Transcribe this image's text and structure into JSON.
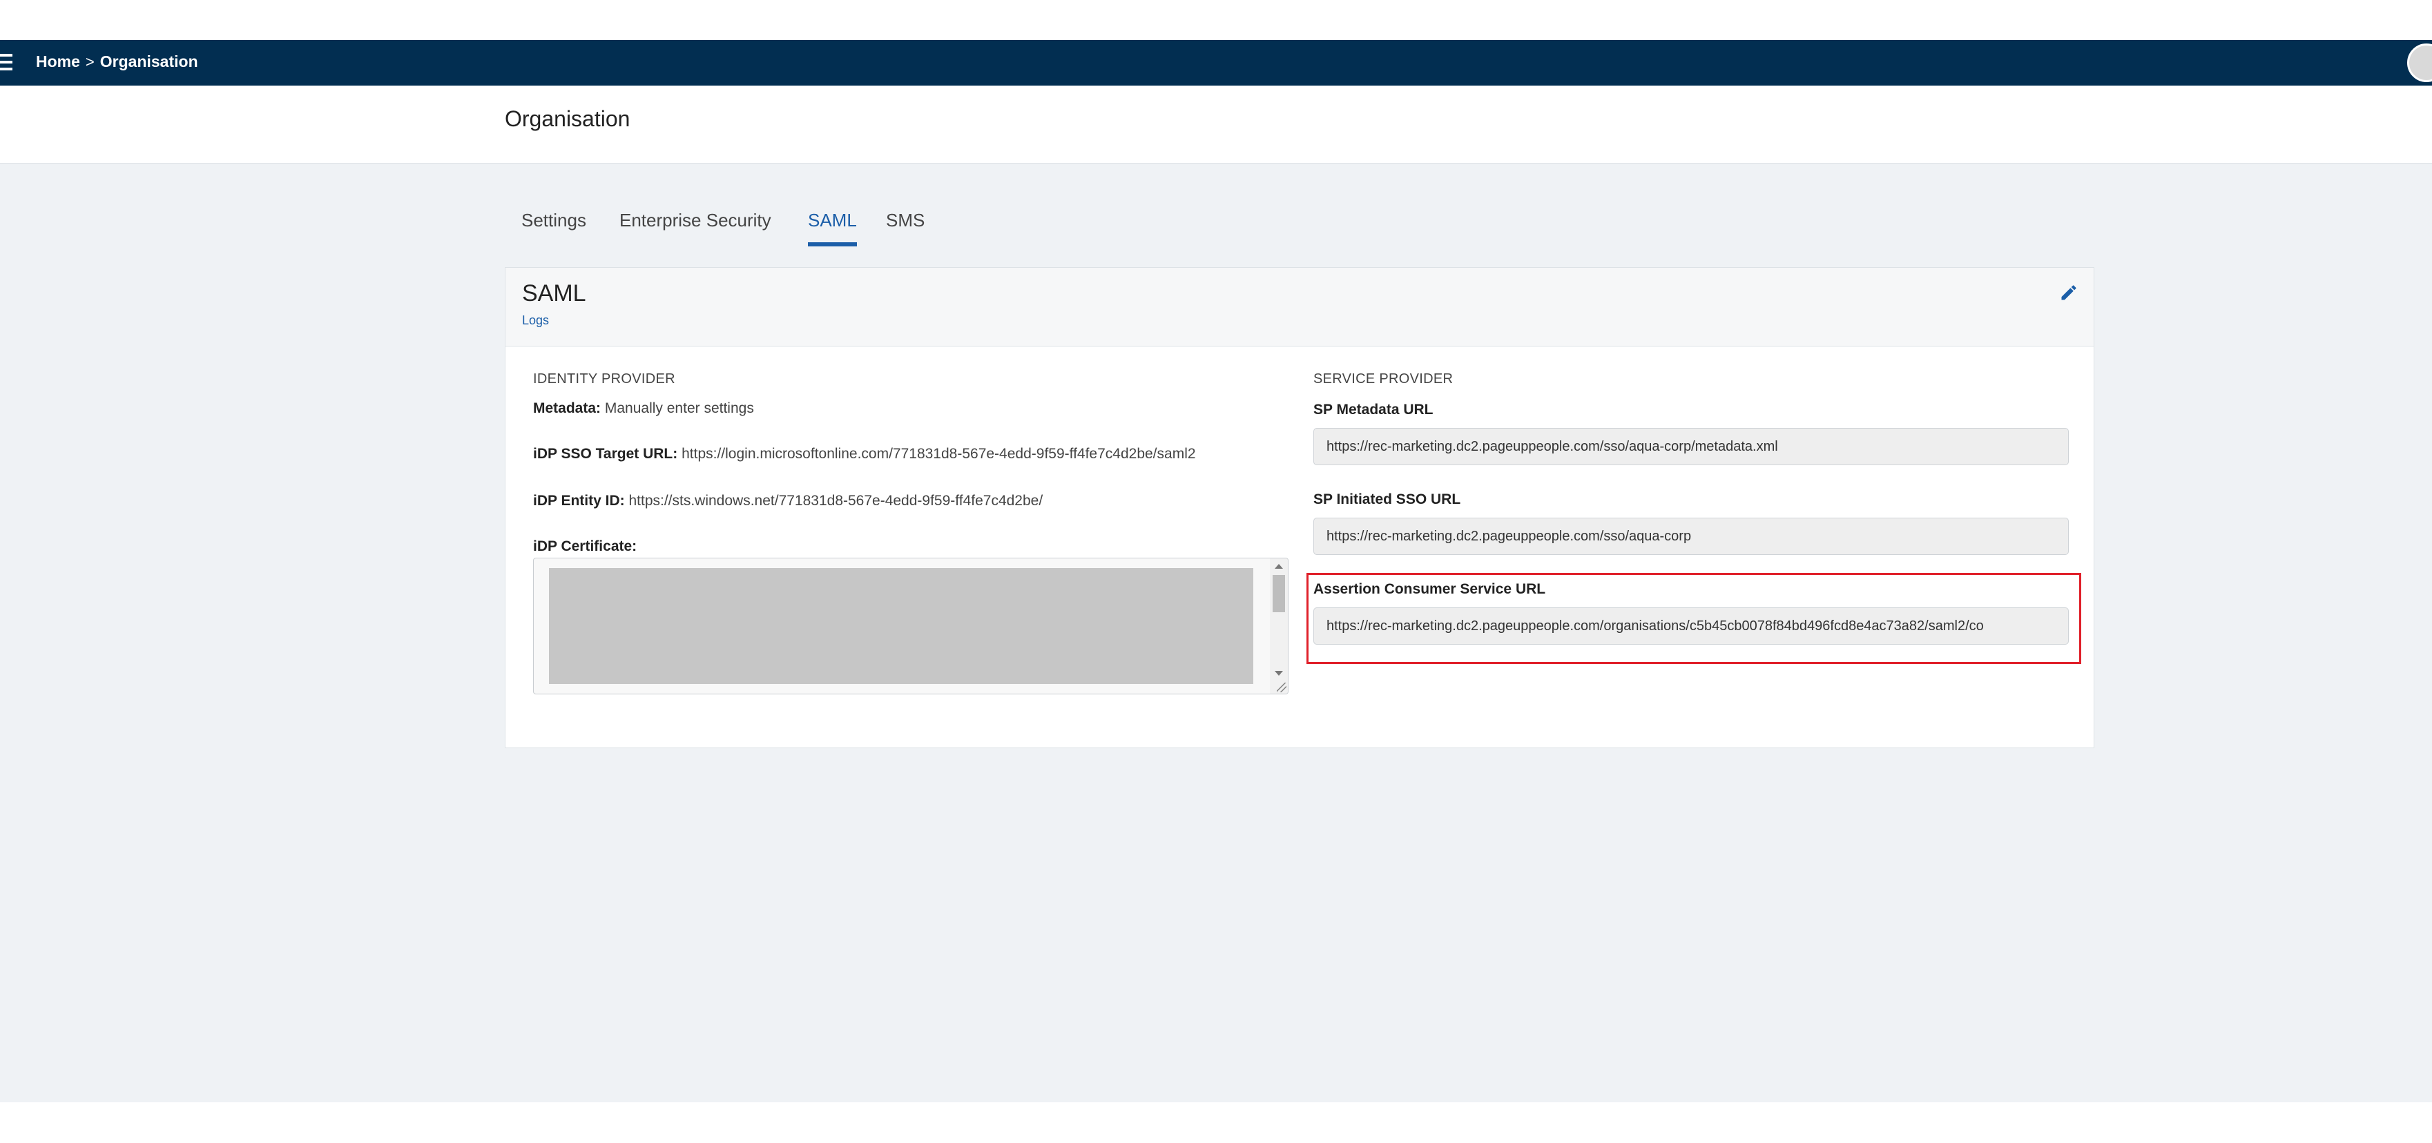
{
  "topbar": {
    "breadcrumb": {
      "home": "Home",
      "separator": ">",
      "current": "Organisation"
    }
  },
  "page": {
    "title": "Organisation"
  },
  "tabs": [
    {
      "label": "Settings",
      "active": false
    },
    {
      "label": "Enterprise Security",
      "active": false
    },
    {
      "label": "SAML",
      "active": true
    },
    {
      "label": "SMS",
      "active": false
    }
  ],
  "card": {
    "title": "SAML",
    "logs_link": "Logs"
  },
  "identity_provider": {
    "heading": "IDENTITY PROVIDER",
    "metadata_key": "Metadata:",
    "metadata_value": "Manually enter settings",
    "sso_url_key": "iDP SSO Target URL:",
    "sso_url_value": "https://login.microsoftonline.com/771831d8-567e-4edd-9f59-ff4fe7c4d2be/saml2",
    "entity_id_key": "iDP Entity ID:",
    "entity_id_value": "https://sts.windows.net/771831d8-567e-4edd-9f59-ff4fe7c4d2be/",
    "certificate_key": "iDP Certificate:"
  },
  "service_provider": {
    "heading": "SERVICE PROVIDER",
    "sp_metadata_label": "SP Metadata URL",
    "sp_metadata_value": "https://rec-marketing.dc2.pageuppeople.com/sso/aqua-corp/metadata.xml",
    "sp_sso_label": "SP Initiated SSO URL",
    "sp_sso_value": "https://rec-marketing.dc2.pageuppeople.com/sso/aqua-corp",
    "acs_label": "Assertion Consumer Service URL",
    "acs_value": "https://rec-marketing.dc2.pageuppeople.com/organisations/c5b45cb0078f84bd496fcd8e4ac73a82/saml2/co"
  },
  "colors": {
    "topbar": "#022e51",
    "accent": "#1b5ea8",
    "background": "#eff2f5",
    "highlight": "#e0202a"
  }
}
